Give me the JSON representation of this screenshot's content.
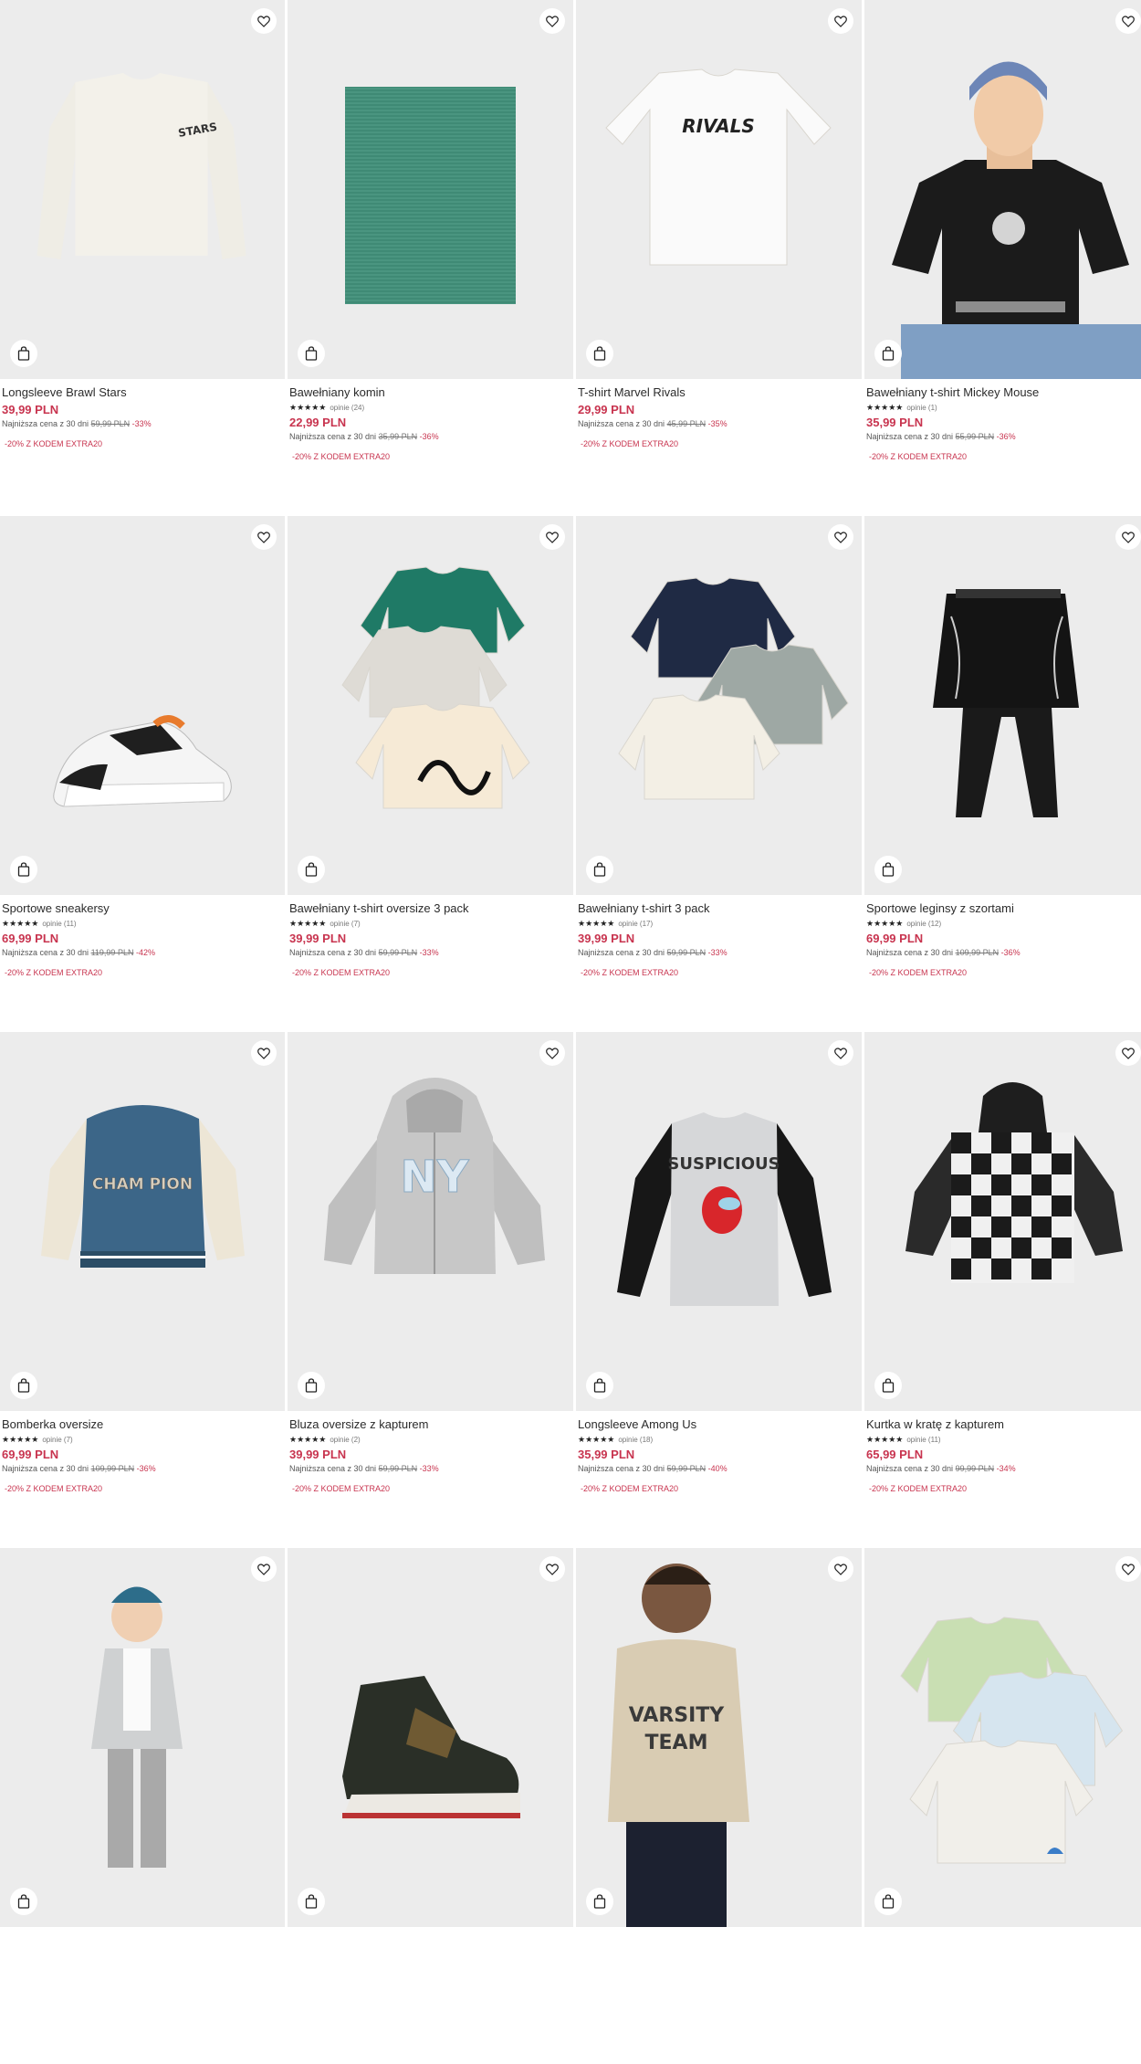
{
  "products": [
    {
      "name": "Longsleeve Brawl Stars",
      "reviews": "",
      "price": "39,99 PLN",
      "lowest_label": "Najniższa cena z 30 dni",
      "old_price": "59,99 PLN",
      "discount": "-33%",
      "promo": "-20% Z KODEM EXTRA20",
      "image": "white-longsleeve",
      "print": "STARS"
    },
    {
      "name": "Bawełniany komin",
      "reviews": "opinie (24)",
      "price": "22,99 PLN",
      "lowest_label": "Najniższa cena z 30 dni",
      "old_price": "35,99 PLN",
      "discount": "-36%",
      "promo": "-20% Z KODEM EXTRA20",
      "image": "green-snood"
    },
    {
      "name": "T-shirt Marvel Rivals",
      "reviews": "",
      "price": "29,99 PLN",
      "lowest_label": "Najniższa cena z 30 dni",
      "old_price": "45,99 PLN",
      "discount": "-35%",
      "promo": "-20% Z KODEM EXTRA20",
      "image": "white-tshirt",
      "print": "RIVALS"
    },
    {
      "name": "Bawełniany t-shirt Mickey Mouse",
      "reviews": "opinie (1)",
      "price": "35,99 PLN",
      "lowest_label": "Najniższa cena z 30 dni",
      "old_price": "55,99 PLN",
      "discount": "-36%",
      "promo": "-20% Z KODEM EXTRA20",
      "image": "boy-black-tshirt"
    },
    {
      "name": "Sportowe sneakersy",
      "reviews": "opinie (11)",
      "price": "69,99 PLN",
      "lowest_label": "Najniższa cena z 30 dni",
      "old_price": "119,99 PLN",
      "discount": "-42%",
      "promo": "-20% Z KODEM EXTRA20",
      "image": "sneaker"
    },
    {
      "name": "Bawełniany t-shirt oversize 3 pack",
      "reviews": "opinie (7)",
      "price": "39,99 PLN",
      "lowest_label": "Najniższa cena z 30 dni",
      "old_price": "59,99 PLN",
      "discount": "-33%",
      "promo": "-20% Z KODEM EXTRA20",
      "image": "tshirt-pack-green"
    },
    {
      "name": "Bawełniany t-shirt 3 pack",
      "reviews": "opinie (17)",
      "price": "39,99 PLN",
      "lowest_label": "Najniższa cena z 30 dni",
      "old_price": "59,99 PLN",
      "discount": "-33%",
      "promo": "-20% Z KODEM EXTRA20",
      "image": "tshirt-pack-navy"
    },
    {
      "name": "Sportowe leginsy z szortami",
      "reviews": "opinie (12)",
      "price": "69,99 PLN",
      "lowest_label": "Najniższa cena z 30 dni",
      "old_price": "109,99 PLN",
      "discount": "-36%",
      "promo": "-20% Z KODEM EXTRA20",
      "image": "leggings-skirt"
    },
    {
      "name": "Bomberka oversize",
      "reviews": "opinie (7)",
      "price": "69,99 PLN",
      "lowest_label": "Najniższa cena z 30 dni",
      "old_price": "109,99 PLN",
      "discount": "-36%",
      "promo": "-20% Z KODEM EXTRA20",
      "image": "bomber",
      "print": "CHAM PION"
    },
    {
      "name": "Bluza oversize z kapturem",
      "reviews": "opinie (2)",
      "price": "39,99 PLN",
      "lowest_label": "Najniższa cena z 30 dni",
      "old_price": "59,99 PLN",
      "discount": "-33%",
      "promo": "-20% Z KODEM EXTRA20",
      "image": "grey-hoodie",
      "print": "NY"
    },
    {
      "name": "Longsleeve Among Us",
      "reviews": "opinie (18)",
      "price": "35,99 PLN",
      "lowest_label": "Najniższa cena z 30 dni",
      "old_price": "59,99 PLN",
      "discount": "-40%",
      "promo": "-20% Z KODEM EXTRA20",
      "image": "among-us",
      "print": "SUSPICIOUS"
    },
    {
      "name": "Kurtka w kratę z kapturem",
      "reviews": "opinie (11)",
      "price": "65,99 PLN",
      "lowest_label": "Najniższa cena z 30 dni",
      "old_price": "99,99 PLN",
      "discount": "-34%",
      "promo": "-20% Z KODEM EXTRA20",
      "image": "check-jacket"
    },
    {
      "name": "",
      "image": "kid-check-shirt"
    },
    {
      "name": "",
      "image": "high-sneaker"
    },
    {
      "name": "",
      "image": "kid-varsity",
      "print": "VARSITY TEAM"
    },
    {
      "name": "",
      "image": "sweatshirt-pack"
    }
  ],
  "stars": "★★★★★",
  "colors": {
    "price": "#c8344f",
    "background": "#ececec"
  },
  "icons": {
    "favorite": "heart-icon",
    "cart": "shopping-bag-icon"
  }
}
